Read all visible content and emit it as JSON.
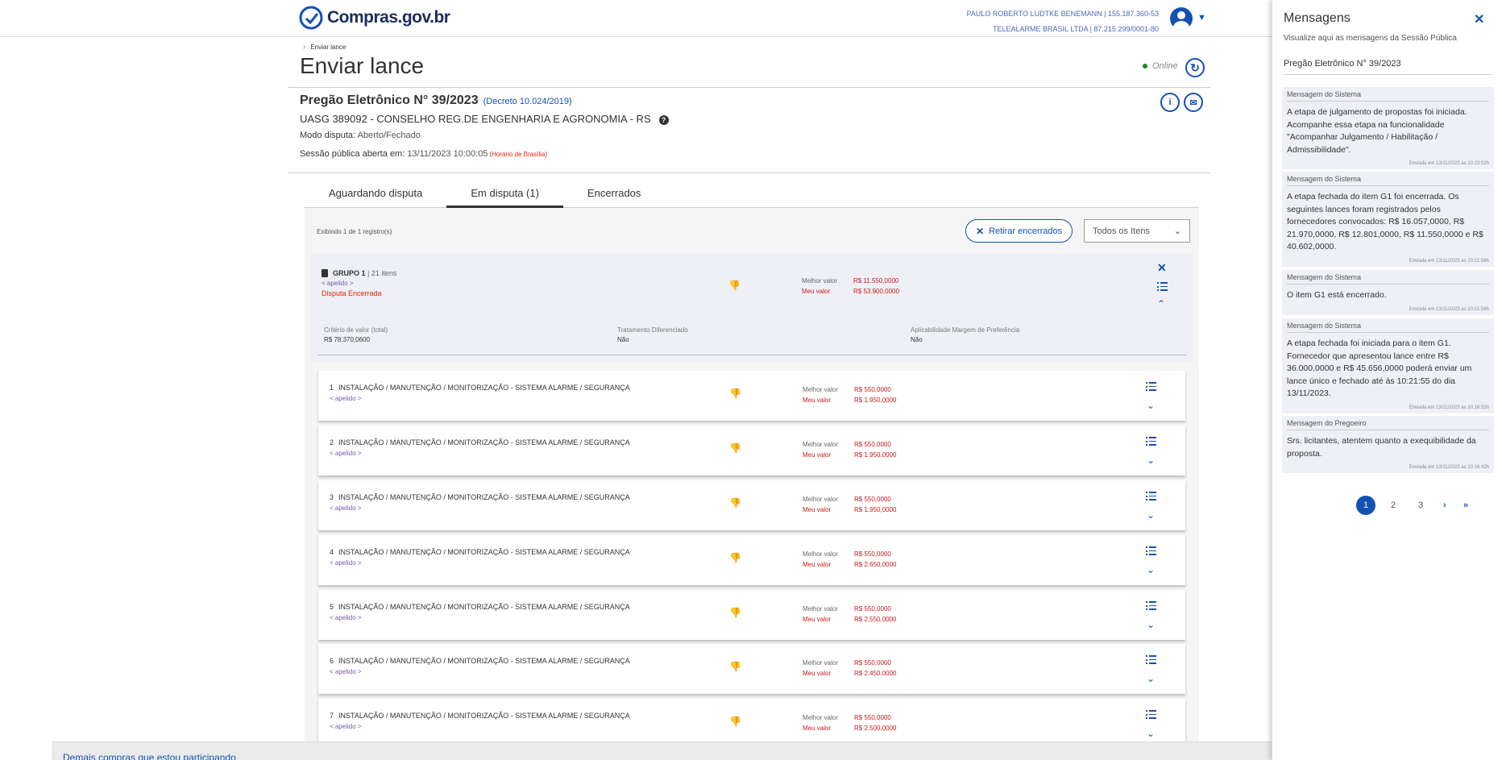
{
  "header": {
    "logo_main": "Compras.",
    "logo_suffix": "gov.br",
    "user_line1": "PAULO ROBERTO LUDTKE BENEMANN | 155.187.360-53",
    "user_line2": "TELEALARME BRASIL LTDA | 87.215.299/0001-80"
  },
  "breadcrumb": {
    "item": "Enviar lance"
  },
  "page": {
    "title": "Enviar lance",
    "status": "Online"
  },
  "pregao": {
    "title": "Pregão Eletrônico N° 39/2023",
    "decreto": "(Decreto 10.024/2019)",
    "uasg": "UASG 389092 - CONSELHO REG.DE ENGENHARIA E AGRONOMIA - RS",
    "modo_label": "Modo disputa:",
    "modo_value": "Aberto/Fechado",
    "sessao_label": "Sessão pública aberta em:",
    "sessao_value": "13/11/2023 10:00:05",
    "sessao_tz": "(Horário de Brasília)"
  },
  "tabs": [
    {
      "label": "Aguardando disputa"
    },
    {
      "label": "Em disputa (1)"
    },
    {
      "label": "Encerrados"
    }
  ],
  "list": {
    "count": "Exibindo 1 de 1 registro(s)",
    "retirar_label": "Retirar encerrados",
    "filter_value": "Todos os Itens"
  },
  "group": {
    "title": "GRUPO 1",
    "items_count": "| 21 itens",
    "apelido": "< apelido >",
    "status": "Disputa Encerrada",
    "best_label": "Melhor valor",
    "best_value": "R$ 11.550,0000",
    "mine_label": "Meu valor",
    "mine_value": "R$ 53.900,0000",
    "criterio_label": "Critério de valor (total)",
    "criterio_value": "R$ 78.370,0600",
    "tratamento_label": "Tratamento Diferenciado",
    "tratamento_value": "Não",
    "margem_label": "Aplicabilidade Margem de Preferência",
    "margem_value": "Não"
  },
  "items": [
    {
      "num": "1",
      "title": "INSTALAÇÃO / MANUTENÇÃO / MONITORIZAÇÃO - SISTEMA ALARME / SEGURANÇA",
      "apelido": "< apelido >",
      "best_label": "Melhor valor",
      "best": "R$ 550,0000",
      "mine_label": "Meu valor",
      "mine": "R$ 1.950,0000"
    },
    {
      "num": "2",
      "title": "INSTALAÇÃO / MANUTENÇÃO / MONITORIZAÇÃO - SISTEMA ALARME / SEGURANÇA",
      "apelido": "< apelido >",
      "best_label": "Melhor valor",
      "best": "R$ 550,0000",
      "mine_label": "Meu valor",
      "mine": "R$ 1.950,0000"
    },
    {
      "num": "3",
      "title": "INSTALAÇÃO / MANUTENÇÃO / MONITORIZAÇÃO - SISTEMA ALARME / SEGURANÇA",
      "apelido": "< apelido >",
      "best_label": "Melhor valor",
      "best": "R$ 550,0000",
      "mine_label": "Meu valor",
      "mine": "R$ 1.950,0000"
    },
    {
      "num": "4",
      "title": "INSTALAÇÃO / MANUTENÇÃO / MONITORIZAÇÃO - SISTEMA ALARME / SEGURANÇA",
      "apelido": "< apelido >",
      "best_label": "Melhor valor",
      "best": "R$ 550,0000",
      "mine_label": "Meu valor",
      "mine": "R$ 2.650,0000"
    },
    {
      "num": "5",
      "title": "INSTALAÇÃO / MANUTENÇÃO / MONITORIZAÇÃO - SISTEMA ALARME / SEGURANÇA",
      "apelido": "< apelido >",
      "best_label": "Melhor valor",
      "best": "R$ 550,0000",
      "mine_label": "Meu valor",
      "mine": "R$ 2.550,0000"
    },
    {
      "num": "6",
      "title": "INSTALAÇÃO / MANUTENÇÃO / MONITORIZAÇÃO - SISTEMA ALARME / SEGURANÇA",
      "apelido": "< apelido >",
      "best_label": "Melhor valor",
      "best": "R$ 550,0000",
      "mine_label": "Meu valor",
      "mine": "R$ 2.450,0000"
    },
    {
      "num": "7",
      "title": "INSTALAÇÃO / MANUTENÇÃO / MONITORIZAÇÃO - SISTEMA ALARME / SEGURANÇA",
      "apelido": "< apelido >",
      "best_label": "Melhor valor",
      "best": "R$ 550,0000",
      "mine_label": "Meu valor",
      "mine": "R$ 2.500,0000"
    }
  ],
  "footer": {
    "link": "Demais compras que estou participando"
  },
  "messages_panel": {
    "title": "Mensagens",
    "subtitle": "Visualize aqui as mensagens da Sessão Pública",
    "pregao": "Pregão Eletrônico N° 39/2023",
    "messages": [
      {
        "from": "Mensagem do Sistema",
        "text": "A etapa de julgamento de propostas foi iniciada. Acompanhe essa etapa na funcionalidade \"Acompanhar Julgamento / Habilitação / Admissibilidade\".",
        "time": "Enviada em 13/11/2023 às 10:23:02h"
      },
      {
        "from": "Mensagem do Sistema",
        "text": "A etapa fechada do item G1 foi encerrada. Os seguintes lances foram registrados pelos fornecedores convocados: R$ 16.057,0000, R$ 21.970,0000, R$ 12.801,0000, R$ 11.550,0000 e R$ 40.602,0000.",
        "time": "Enviada em 13/11/2023 às 10:21:56h"
      },
      {
        "from": "Mensagem do Sistema",
        "text": "O item G1 está encerrado.",
        "time": "Enviada em 13/11/2023 às 10:21:56h"
      },
      {
        "from": "Mensagem do Sistema",
        "text": "A etapa fechada foi iniciada para o item G1. Fornecedor que apresentou lance entre R$ 36.000,0000 e R$ 45.656,0000 poderá enviar um lance único e fechado até às 10:21:55 do dia 13/11/2023.",
        "time": "Enviada em 13/11/2023 às 10:16:55h"
      },
      {
        "from": "Mensagem do Pregoeiro",
        "text": "Srs. licitantes, atentem quanto a exequibilidade da proposta.",
        "time": "Enviada em 13/11/2023 às 10:16:42h"
      }
    ],
    "pages": [
      "1",
      "2",
      "3"
    ]
  },
  "colors": {
    "accent": "#1351b4",
    "danger": "#c41c1c",
    "online": "#168821"
  }
}
